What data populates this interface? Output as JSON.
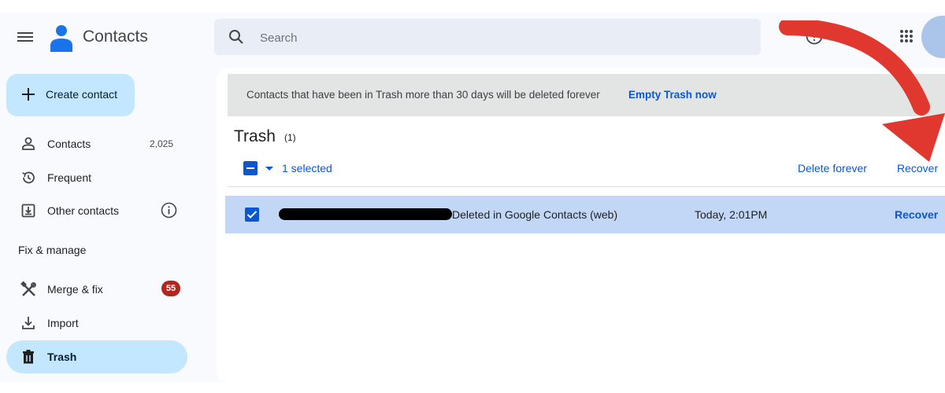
{
  "header": {
    "app_title": "Contacts",
    "search_placeholder": "Search",
    "icons": [
      "menu-icon",
      "contacts-logo",
      "search-icon",
      "help-icon",
      "settings-icon",
      "apps-grid-icon",
      "avatar"
    ]
  },
  "sidebar": {
    "create_label": "Create contact",
    "items": [
      {
        "label": "Contacts",
        "count": "2,025",
        "icon": "person-icon"
      },
      {
        "label": "Frequent",
        "icon": "history-icon"
      },
      {
        "label": "Other contacts",
        "icon": "download-box-icon"
      }
    ],
    "section_heading": "Fix & manage",
    "manage_items": [
      {
        "label": "Merge & fix",
        "badge": "55",
        "icon": "merge-icon"
      },
      {
        "label": "Import",
        "icon": "import-icon"
      },
      {
        "label": "Trash",
        "icon": "trash-icon",
        "active": true
      }
    ]
  },
  "main": {
    "banner": {
      "message": "Contacts that have been in Trash more than 30 days will be deleted forever",
      "action": "Empty Trash now"
    },
    "title": "Trash",
    "count": "(1)",
    "selection_text": "1 selected",
    "delete_forever_label": "Delete forever",
    "recover_label": "Recover",
    "rows": [
      {
        "source": "Deleted in Google Contacts (web)",
        "time": "Today, 2:01PM",
        "action": "Recover",
        "selected": true
      }
    ]
  },
  "colors": {
    "accent": "#0b57d0",
    "active_nav": "#c2e7ff",
    "selected_row": "#c2d6f5",
    "badge": "#b3261e",
    "annotation_arrow": "#e0382e"
  }
}
